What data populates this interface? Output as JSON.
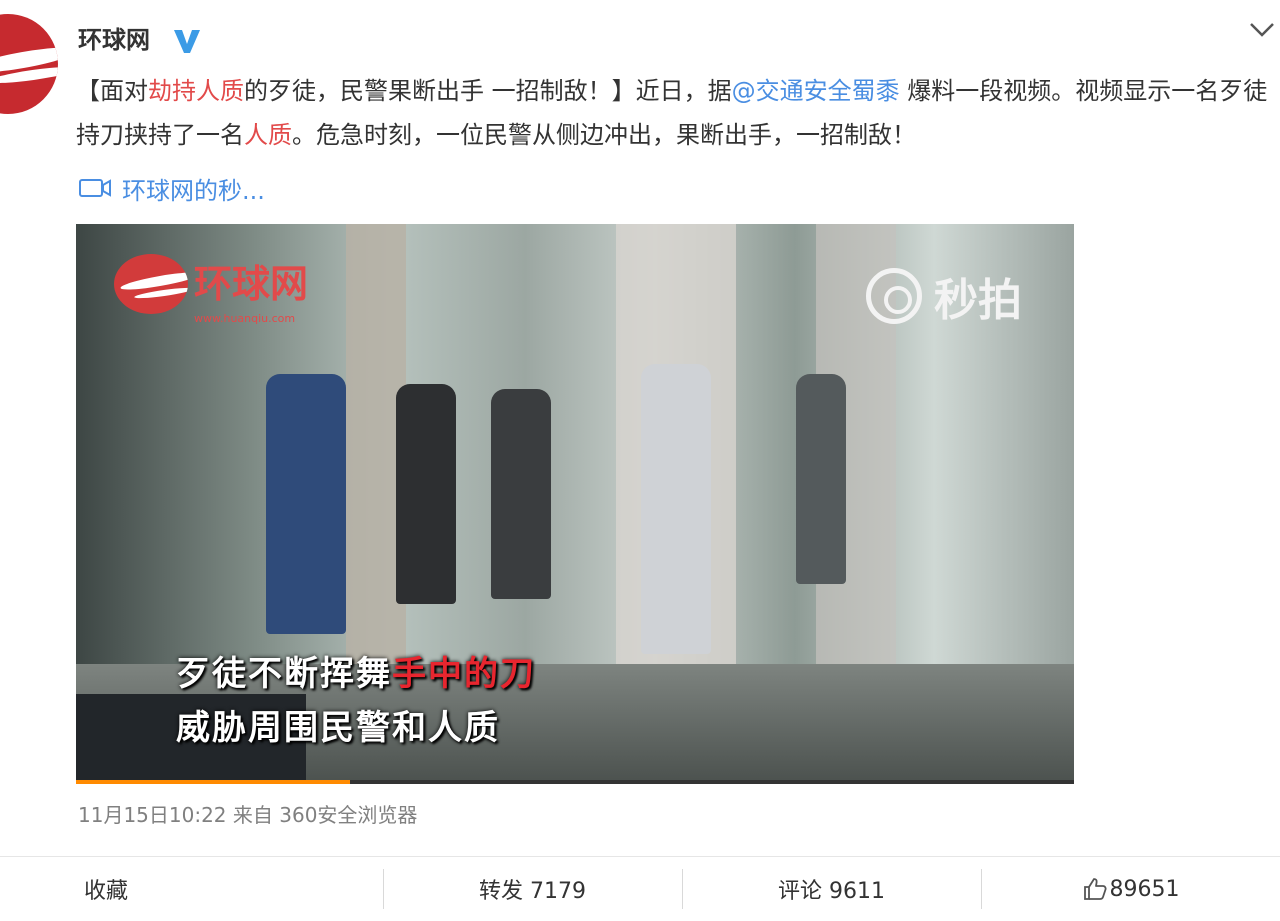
{
  "account": {
    "name": "环球网",
    "verified_icon": "verified-v-icon",
    "menu_icon": "chevron-down-icon"
  },
  "post": {
    "text_part1": "【面对",
    "text_highlight1": "劫持人质",
    "text_part2": "的歹徒，民警果断出手 一招制敌！】近日，据",
    "mention": "@交通安全蜀黍",
    "text_part3": " 爆料一段视频。视频显示一名歹徒持刀挟持了一名",
    "text_highlight2": "人质",
    "text_part4": "。危急时刻，一位民警从侧边冲出，果断出手，一招制敌！",
    "video_link_label": "环球网的秒...",
    "video_link_icon": "video-icon"
  },
  "video": {
    "watermark_left": "环球网",
    "watermark_left_url": "www.huanqiu.com",
    "watermark_right": "秒拍",
    "subtitle_line1_a": "歹徒不断挥舞",
    "subtitle_line1_b": "手中的刀",
    "subtitle_line2": "威胁周围民警和人质",
    "progress_percent": 27.5
  },
  "meta": {
    "timestamp_source": "11月15日10:22 来自 360安全浏览器"
  },
  "actions": {
    "favorite": "收藏",
    "repost": "转发 7179",
    "comment": "评论 9611",
    "like_count": "89651",
    "like_icon": "thumbs-up-icon"
  },
  "colors": {
    "highlight": "#e24a4a",
    "link": "#4a8ee2",
    "verified": "#3b9be6",
    "progress": "#ff8a00"
  }
}
